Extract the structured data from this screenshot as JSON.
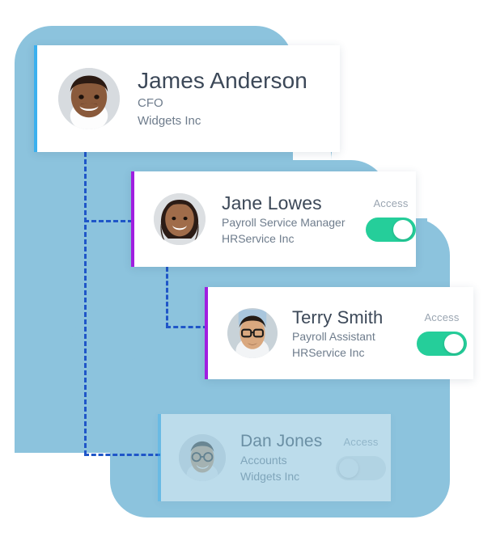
{
  "theme": {
    "blob_blue": "#8cc3dd",
    "connector_blue": "#1f56c8",
    "accent_cyan": "#3ab0ef",
    "accent_purple": "#a01ee0",
    "toggle_on_green": "#25ce9a",
    "toggle_off_grey": "#e6e9ec",
    "name_color": "#3c4858",
    "meta_color": "#6e7c8c"
  },
  "org_chart": {
    "cards": [
      {
        "id": "james-anderson",
        "name": "James Anderson",
        "role": "CFO",
        "org": "Widgets Inc",
        "accent": "cyan",
        "avatar": "avatar-james-anderson",
        "has_access_control": false,
        "access_label": "",
        "access_on": false,
        "dimmed": false
      },
      {
        "id": "jane-lowes",
        "name": "Jane Lowes",
        "role": "Payroll Service Manager",
        "org": "HRService Inc",
        "accent": "purple",
        "avatar": "avatar-jane-lowes",
        "has_access_control": true,
        "access_label": "Access",
        "access_on": true,
        "dimmed": false
      },
      {
        "id": "terry-smith",
        "name": "Terry Smith",
        "role": "Payroll Assistant",
        "org": "HRService Inc",
        "accent": "purple",
        "avatar": "avatar-terry-smith",
        "has_access_control": true,
        "access_label": "Access",
        "access_on": true,
        "dimmed": false
      },
      {
        "id": "dan-jones",
        "name": "Dan Jones",
        "role": "Accounts",
        "org": "Widgets Inc",
        "accent": "cyan",
        "avatar": "avatar-dan-jones",
        "has_access_control": true,
        "access_label": "Access",
        "access_on": false,
        "dimmed": true
      }
    ]
  }
}
